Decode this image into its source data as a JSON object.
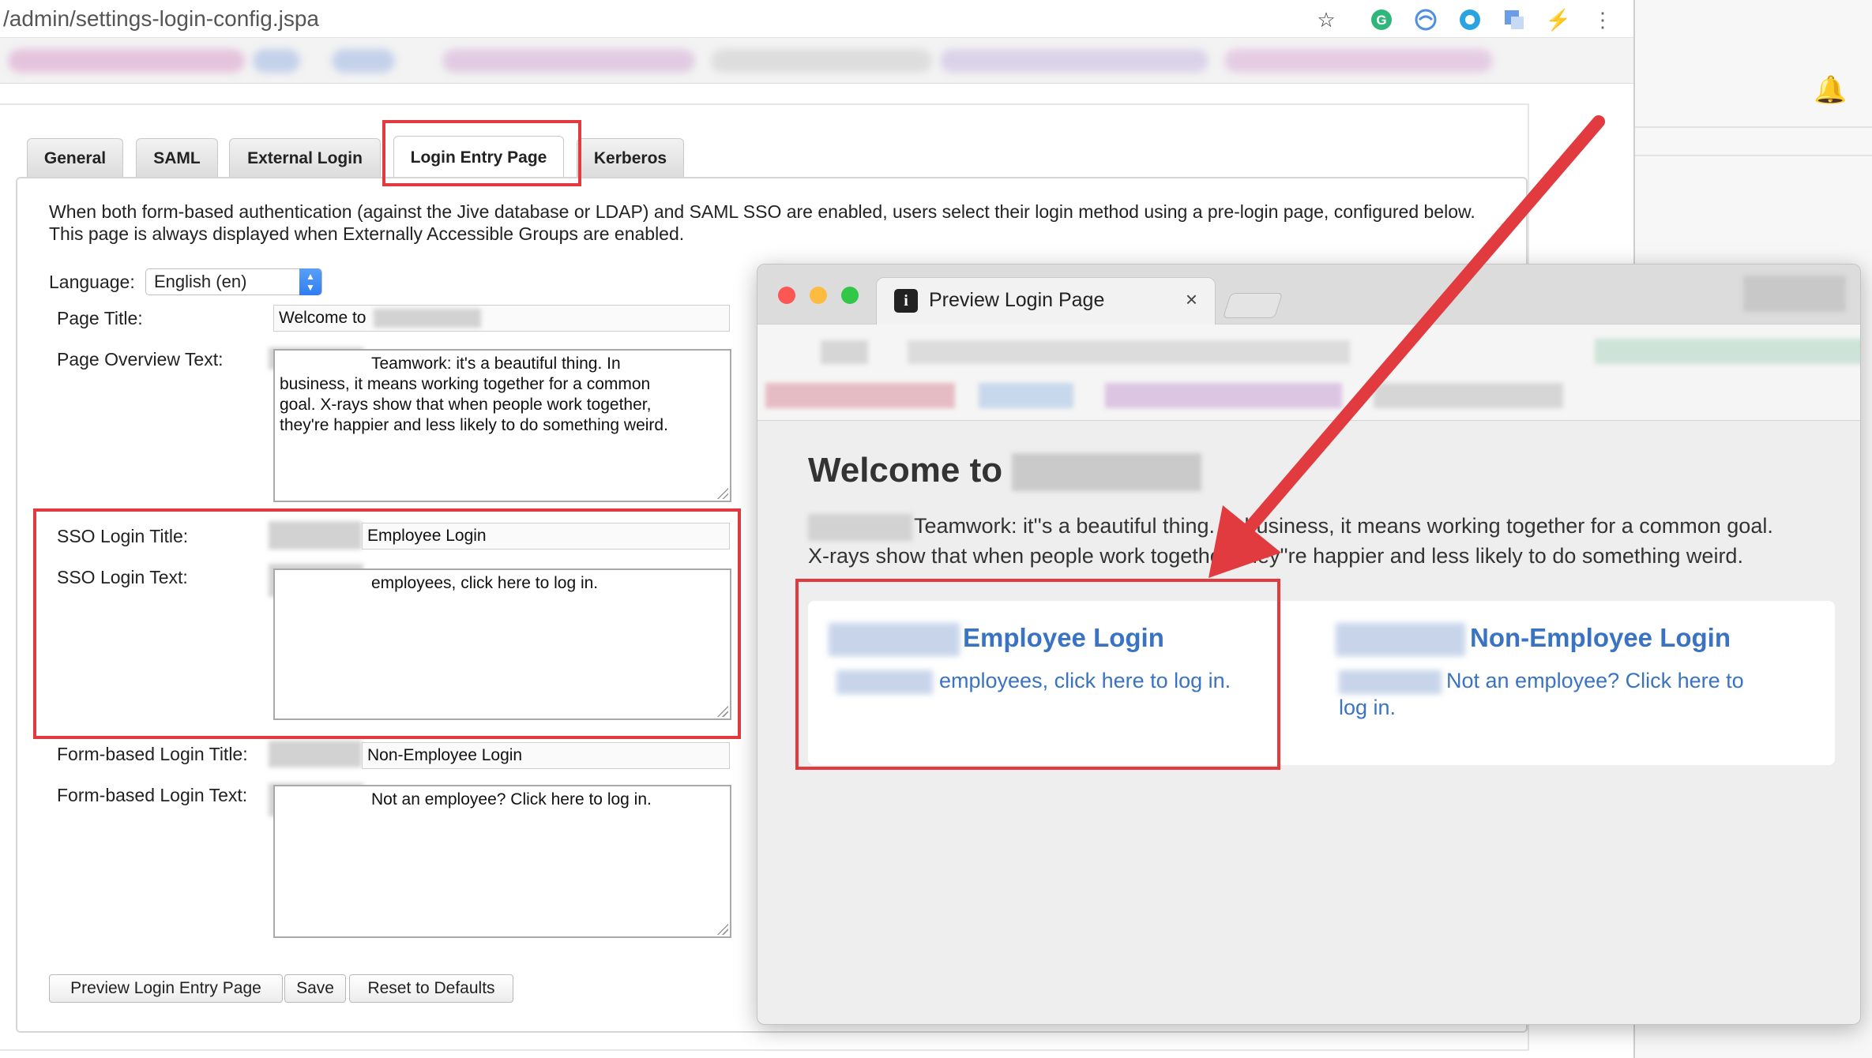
{
  "browser": {
    "url": "/admin/settings-login-config.jspa",
    "toolbar_icons": [
      "star-icon",
      "grammarly-icon",
      "sync-icon",
      "circle-extension-icon",
      "translate-icon",
      "lightning-icon",
      "menu-dots-icon"
    ]
  },
  "tabs": [
    {
      "label": "General"
    },
    {
      "label": "SAML"
    },
    {
      "label": "External Login"
    },
    {
      "label": "Login Entry Page",
      "active": true
    },
    {
      "label": "Kerberos"
    }
  ],
  "intro_text": "When both form-based authentication (against the Jive database or LDAP) and SAML SSO are enabled, users select their login method using a pre-login page, configured below. This page is always displayed when Externally Accessible Groups are enabled.",
  "form": {
    "language_label": "Language:",
    "language_value": "English (en)",
    "page_title_label": "Page Title:",
    "page_title_value": "Welcome to",
    "overview_label": "Page Overview Text:",
    "overview_line1": "Teamwork: it's a beautiful thing. In",
    "overview_line2": "business, it means working together for a common",
    "overview_line3": "goal. X-rays show that when people work together,",
    "overview_line4": "they're happier and less likely to do something weird.",
    "sso_title_label": "SSO Login Title:",
    "sso_title_value": "Employee Login",
    "sso_text_label": "SSO Login Text:",
    "sso_text_value": "employees, click here to log in.",
    "form_title_label": "Form-based Login Title:",
    "form_title_value": "Non-Employee Login",
    "form_text_label": "Form-based Login Text:",
    "form_text_value": "Not an employee? Click here to log in."
  },
  "buttons": {
    "preview": "Preview Login Entry Page",
    "save": "Save",
    "reset": "Reset to Defaults"
  },
  "preview_window": {
    "tab_title": "Preview Login Page",
    "tab_close": "×",
    "heading": "Welcome to",
    "overview_line1": "Teamwork: it''s a beautiful thing. In business, it means working together for a common goal.",
    "overview_line2": "X-rays show that when people work together, they''re happier and less likely to do something weird.",
    "employee_title": "Employee Login",
    "employee_text": "employees, click here to log in.",
    "non_employee_title": "Non-Employee Login",
    "non_employee_text_line1": "Not an employee? Click here to",
    "non_employee_text_line2": "log in."
  },
  "colors": {
    "annotation_red": "#e13a3f",
    "link_blue": "#3a73c2",
    "mac_close": "#fc5753",
    "mac_minimize": "#fdbc40",
    "mac_zoom": "#33c748"
  }
}
